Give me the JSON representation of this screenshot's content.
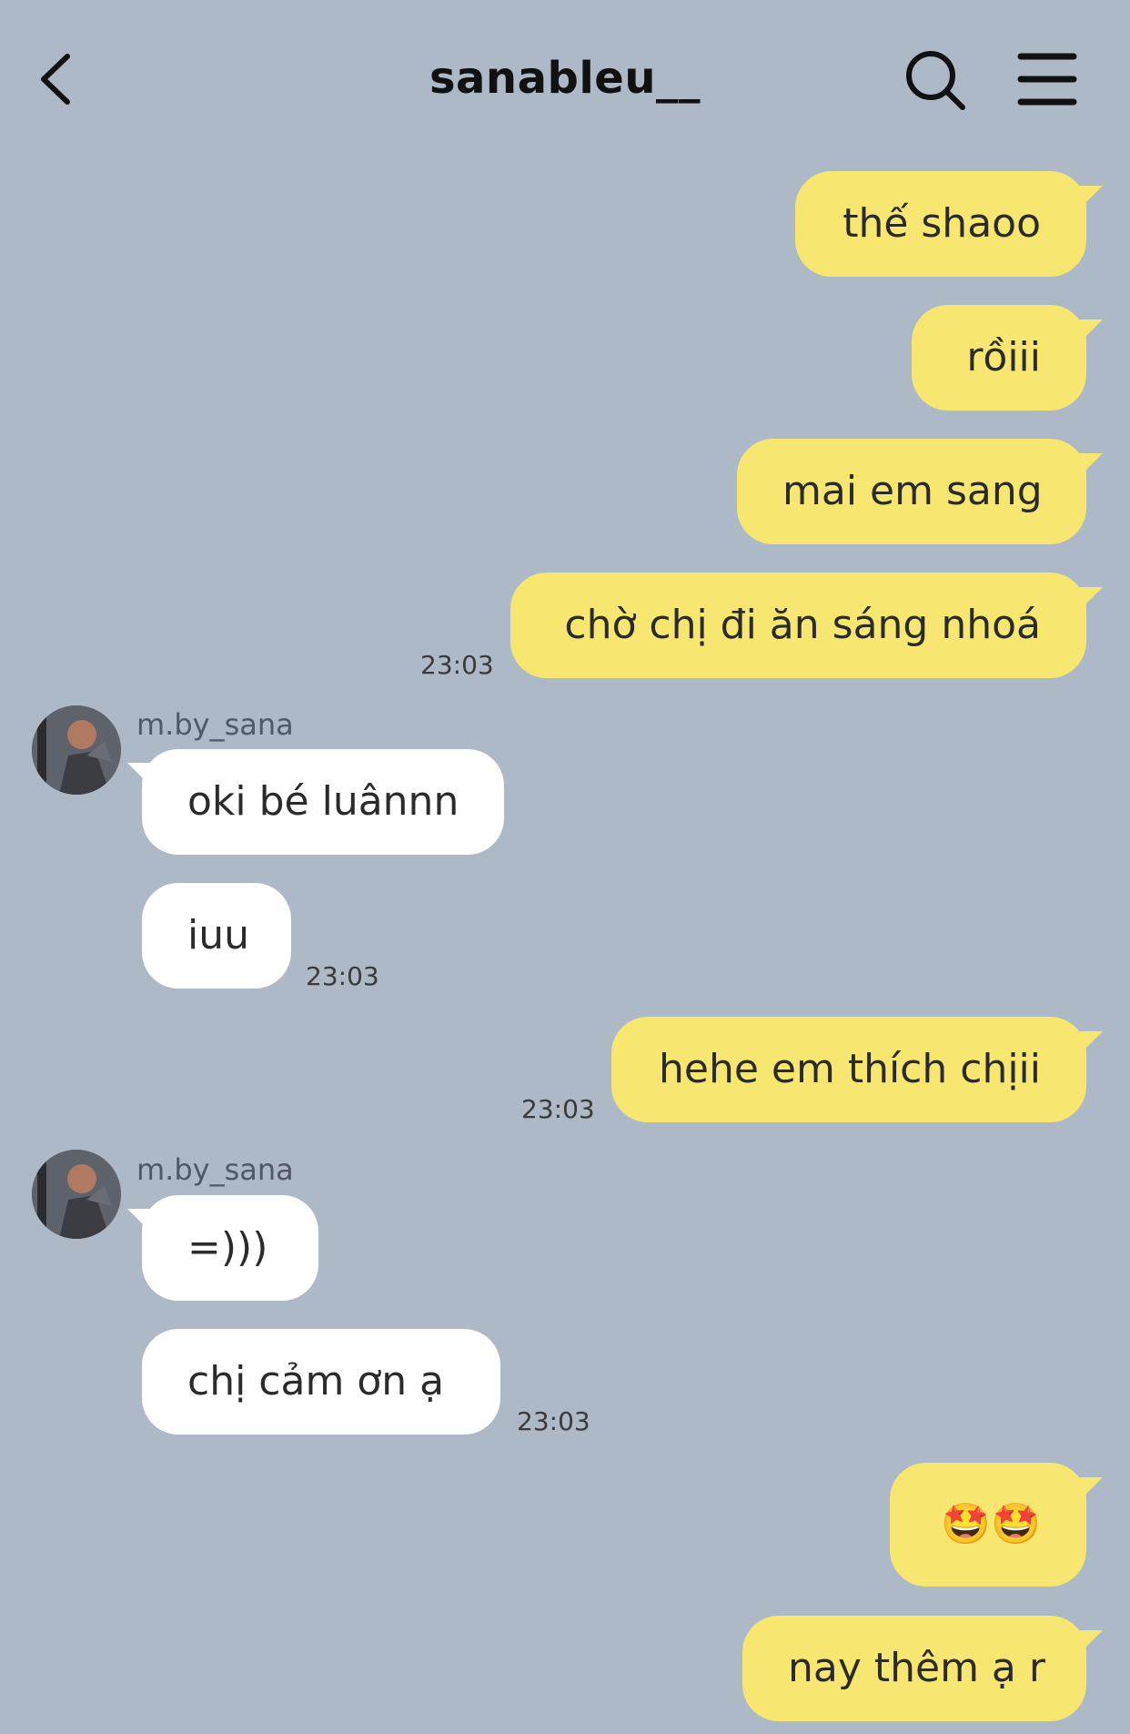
{
  "header": {
    "title": "sanableu__"
  },
  "messages": {
    "m1": {
      "text": "thế shaoo"
    },
    "m2": {
      "text": "rồiii"
    },
    "m3": {
      "text": "mai em sang"
    },
    "m4": {
      "text": "chờ chị đi ăn sáng nhoá",
      "time": "23:03"
    },
    "m5": {
      "sender": "m.by_sana",
      "text": "oki bé luânnn"
    },
    "m6": {
      "text": "iuu",
      "time": "23:03"
    },
    "m7": {
      "text": "hehe em thích chịii",
      "time": "23:03"
    },
    "m8": {
      "sender": "m.by_sana",
      "text": "=)))"
    },
    "m9": {
      "text": "chị cảm ơn ạ",
      "time": "23:03"
    },
    "m10": {
      "text": "🤩🤩"
    },
    "m11": {
      "text": "nay thêm ạ r"
    }
  },
  "colors": {
    "background": "#aeb9c8",
    "outgoing_bubble": "#f7e771",
    "incoming_bubble": "#ffffff"
  }
}
